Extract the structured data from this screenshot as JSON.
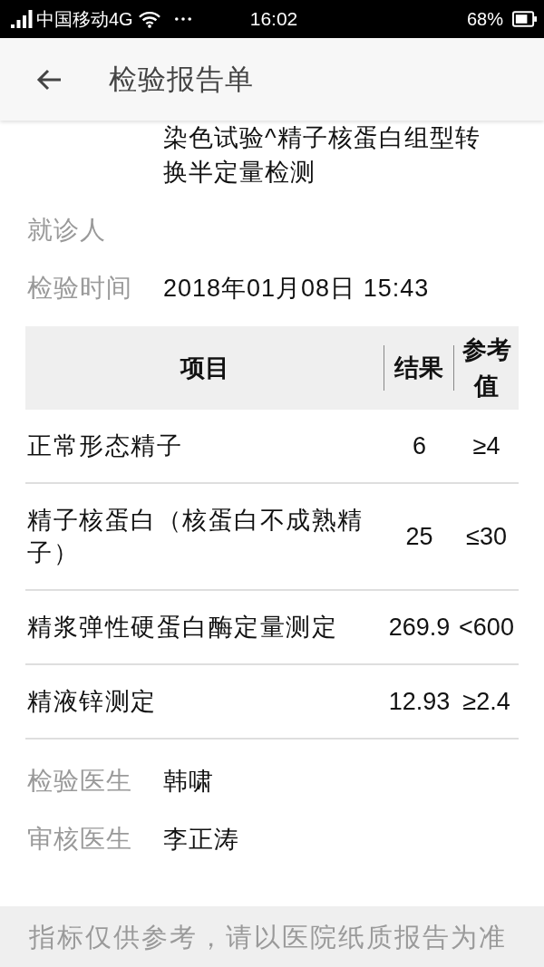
{
  "status_bar": {
    "carrier": "中国移动4G",
    "time": "16:02",
    "battery": "68%"
  },
  "header": {
    "title": "检验报告单"
  },
  "details_top": [
    {
      "value": "染色试验^精子核蛋白组型转换半定量检测"
    },
    {
      "label": "就诊人"
    },
    {
      "label": "检验时间",
      "value": "2018年01月08日 15:43"
    }
  ],
  "table": {
    "columns": [
      "项目",
      "结果",
      "参考值"
    ],
    "rows": [
      {
        "item": "正常形态精子",
        "result": "6",
        "reference": "≥4"
      },
      {
        "item": "精子核蛋白（核蛋白不成熟精子）",
        "result": "25",
        "reference": "≤30"
      },
      {
        "item": "精浆弹性硬蛋白酶定量测定",
        "result": "269.9",
        "reference": "<600"
      },
      {
        "item": "精液锌测定",
        "result": "12.93",
        "reference": "≥2.4"
      }
    ]
  },
  "details_bottom": [
    {
      "label": "检验医生",
      "value": "韩啸"
    },
    {
      "label": "审核医生",
      "value": "李正涛"
    }
  ],
  "footer": {
    "note": "指标仅供参考，请以医院纸质报告为准"
  }
}
